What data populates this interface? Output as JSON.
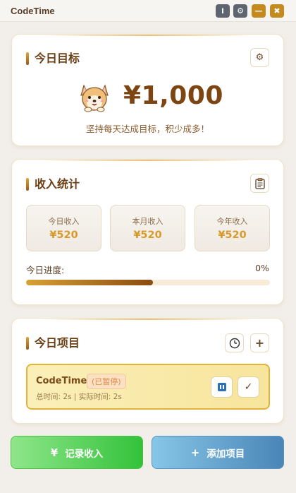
{
  "app": {
    "title": "CodeTime",
    "controls": {
      "info": "i",
      "settings": "⚙",
      "minimize": "—",
      "close": "✖"
    }
  },
  "goal": {
    "title": "今日目标",
    "amount": "¥1,000",
    "motto": "坚持每天达成目标，积少成多！",
    "settings_icon": "⚙"
  },
  "stats": {
    "title": "收入统计",
    "clipboard_icon": "📋",
    "boxes": [
      {
        "label": "今日收入",
        "value": "¥520"
      },
      {
        "label": "本月收入",
        "value": "¥520"
      },
      {
        "label": "今年收入",
        "value": "¥520"
      }
    ],
    "progress_label": "今日进度:",
    "progress_text": "0%",
    "progress_fill_fraction": 0.52
  },
  "projects": {
    "title": "今日项目",
    "clock_icon": "🕒",
    "add_icon": "+",
    "items": [
      {
        "name": "CodeTime",
        "status": "(已暂停)",
        "times": "总时间: 2s | 实际时间: 2s",
        "done_icon": "✓"
      }
    ]
  },
  "actions": {
    "income": {
      "icon": "¥",
      "label": "记录收入"
    },
    "project": {
      "icon": "+",
      "label": "添加项目"
    }
  }
}
